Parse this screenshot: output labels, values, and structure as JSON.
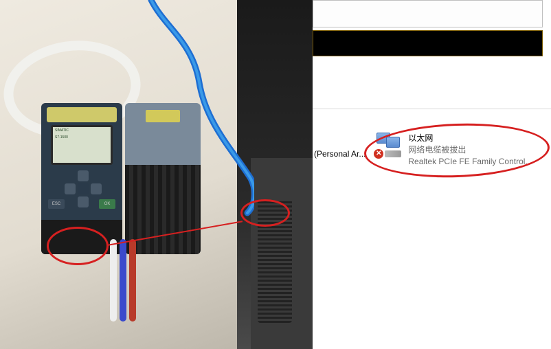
{
  "left_photo": {
    "plc_screen_line1": "SIMATIC",
    "plc_screen_line2": "S7-1500",
    "btn_esc": "ESC",
    "btn_ok": "OK"
  },
  "os_panel": {
    "left_truncated_label": "(Personal Ar...",
    "adapter": {
      "name": "以太网",
      "status": "网络电缆被拔出",
      "description": "Realtek PCIe FE Family Control..."
    }
  },
  "annotations": {
    "color": "#d62020"
  }
}
